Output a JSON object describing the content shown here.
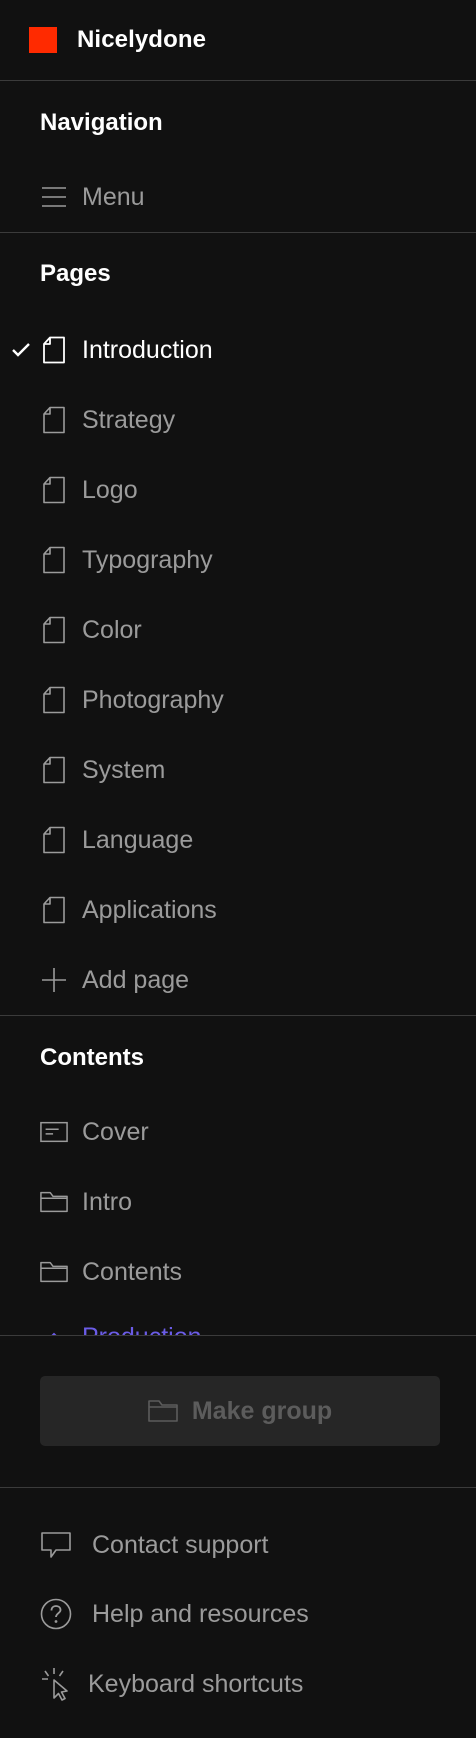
{
  "brand": {
    "name": "Nicelydone",
    "accent_color": "#ff2a00"
  },
  "navigation": {
    "title": "Navigation",
    "items": [
      {
        "label": "Menu",
        "icon": "hamburger-menu-icon"
      }
    ]
  },
  "pages": {
    "title": "Pages",
    "items": [
      {
        "label": "Introduction",
        "icon": "page-icon",
        "active": true
      },
      {
        "label": "Strategy",
        "icon": "page-icon"
      },
      {
        "label": "Logo",
        "icon": "page-icon"
      },
      {
        "label": "Typography",
        "icon": "page-icon"
      },
      {
        "label": "Color",
        "icon": "page-icon"
      },
      {
        "label": "Photography",
        "icon": "page-icon"
      },
      {
        "label": "System",
        "icon": "page-icon"
      },
      {
        "label": "Language",
        "icon": "page-icon"
      },
      {
        "label": "Applications",
        "icon": "page-icon"
      }
    ],
    "add_label": "Add page"
  },
  "contents": {
    "title": "Contents",
    "items": [
      {
        "label": "Cover",
        "icon": "cover-icon"
      },
      {
        "label": "Intro",
        "icon": "folder-icon"
      },
      {
        "label": "Contents",
        "icon": "folder-icon"
      },
      {
        "label": "Production",
        "icon": "chevron-up-icon"
      }
    ]
  },
  "actions": {
    "make_group_label": "Make group"
  },
  "footer": {
    "items": [
      {
        "label": "Contact support",
        "icon": "chat-bubble-icon"
      },
      {
        "label": "Help and resources",
        "icon": "question-circle-icon"
      },
      {
        "label": "Keyboard shortcuts",
        "icon": "cursor-click-icon"
      }
    ]
  }
}
